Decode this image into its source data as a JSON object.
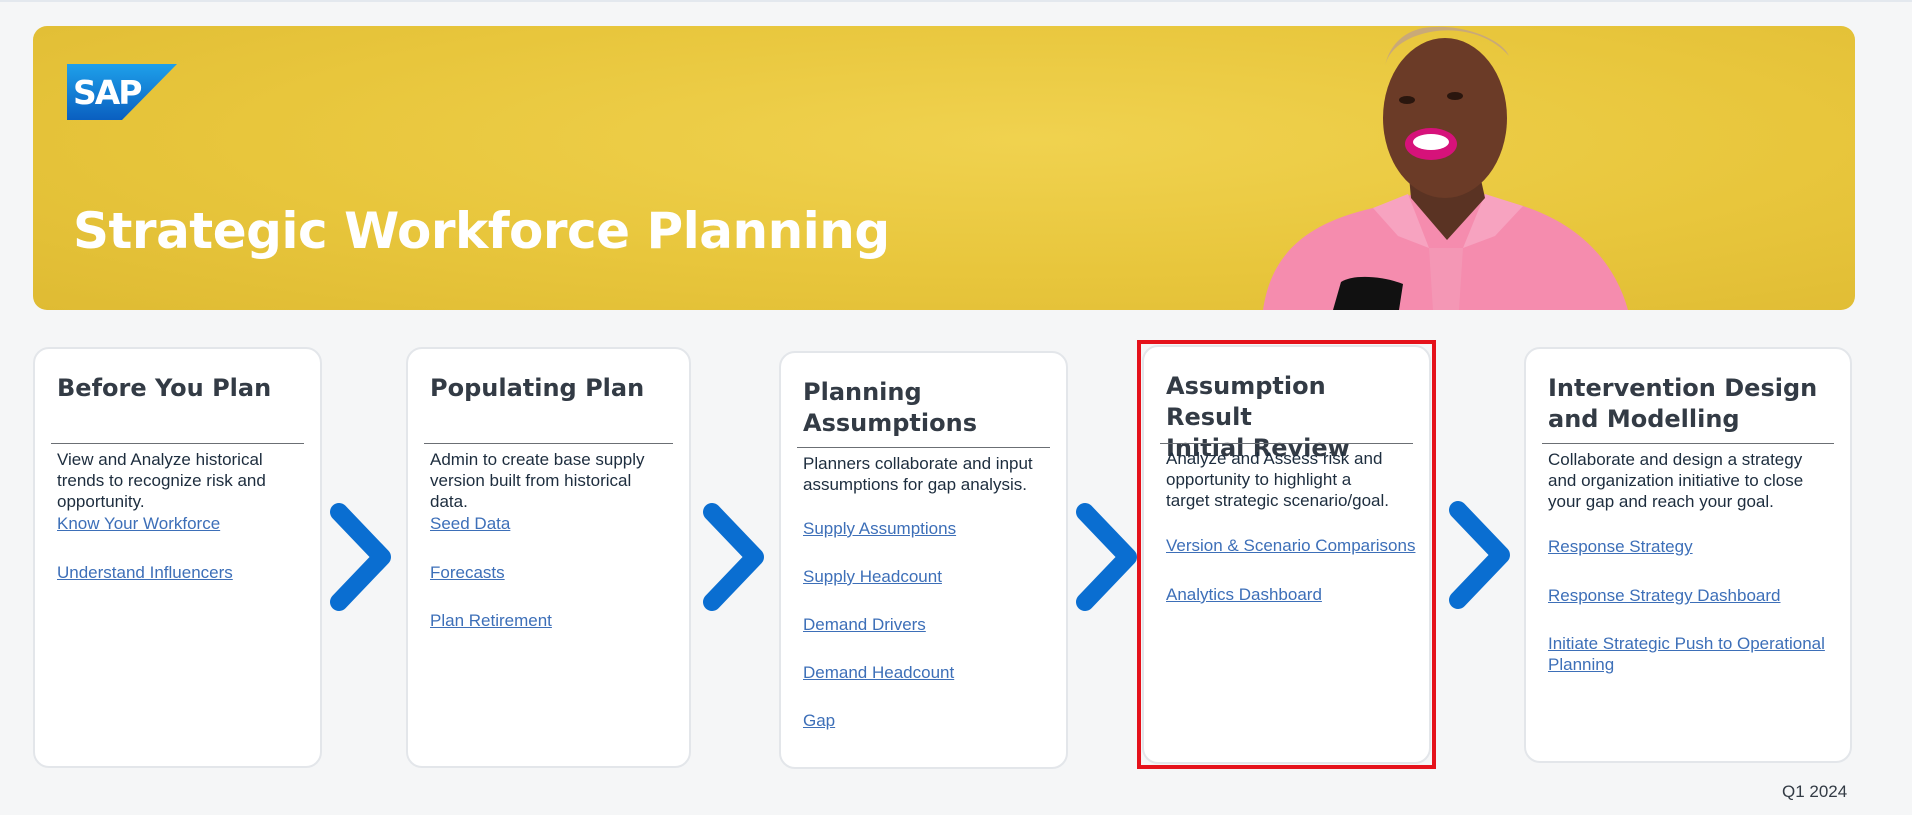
{
  "banner": {
    "logo_text": "SAP",
    "title": "Strategic Workforce Planning"
  },
  "cards": [
    {
      "title": "Before You Plan",
      "description": "View and Analyze historical\ntrends to recognize risk and\nopportunity.",
      "links": [
        "Know Your Workforce",
        "Understand Influencers"
      ]
    },
    {
      "title": "Populating Plan",
      "description": "Admin to create base supply\nversion built from historical\ndata.",
      "links": [
        "Seed Data",
        "Forecasts",
        "Plan Retirement"
      ]
    },
    {
      "title": "Planning\nAssumptions",
      "description": "Planners collaborate and input\nassumptions for gap analysis.",
      "links": [
        "Supply Assumptions",
        "Supply Headcount",
        "Demand Drivers",
        "Demand Headcount",
        "Gap"
      ]
    },
    {
      "title": "Assumption Result\nInitial Review",
      "description": "Analyze and Assess risk and\nopportunity to highlight a\ntarget strategic scenario/goal.",
      "links": [
        "Version & Scenario Comparisons",
        "Analytics Dashboard"
      ]
    },
    {
      "title": "Intervention Design\nand Modelling",
      "description": "Collaborate and design a strategy\nand organization initiative to close\nyour gap and reach your goal.",
      "links": [
        "Response Strategy",
        "Response Strategy Dashboard",
        "Initiate Strategic Push to Operational\nPlanning"
      ]
    }
  ],
  "footer": {
    "label": "Q1 2024"
  },
  "colors": {
    "banner_yellow": "#e8c63c",
    "sap_blue": "#0a6ed1",
    "chevron_blue": "#0a6ed1",
    "link_blue": "#3d6fb8",
    "highlight_red": "#e5121b"
  },
  "icons": {
    "step_arrow": "chevron-right-icon"
  }
}
